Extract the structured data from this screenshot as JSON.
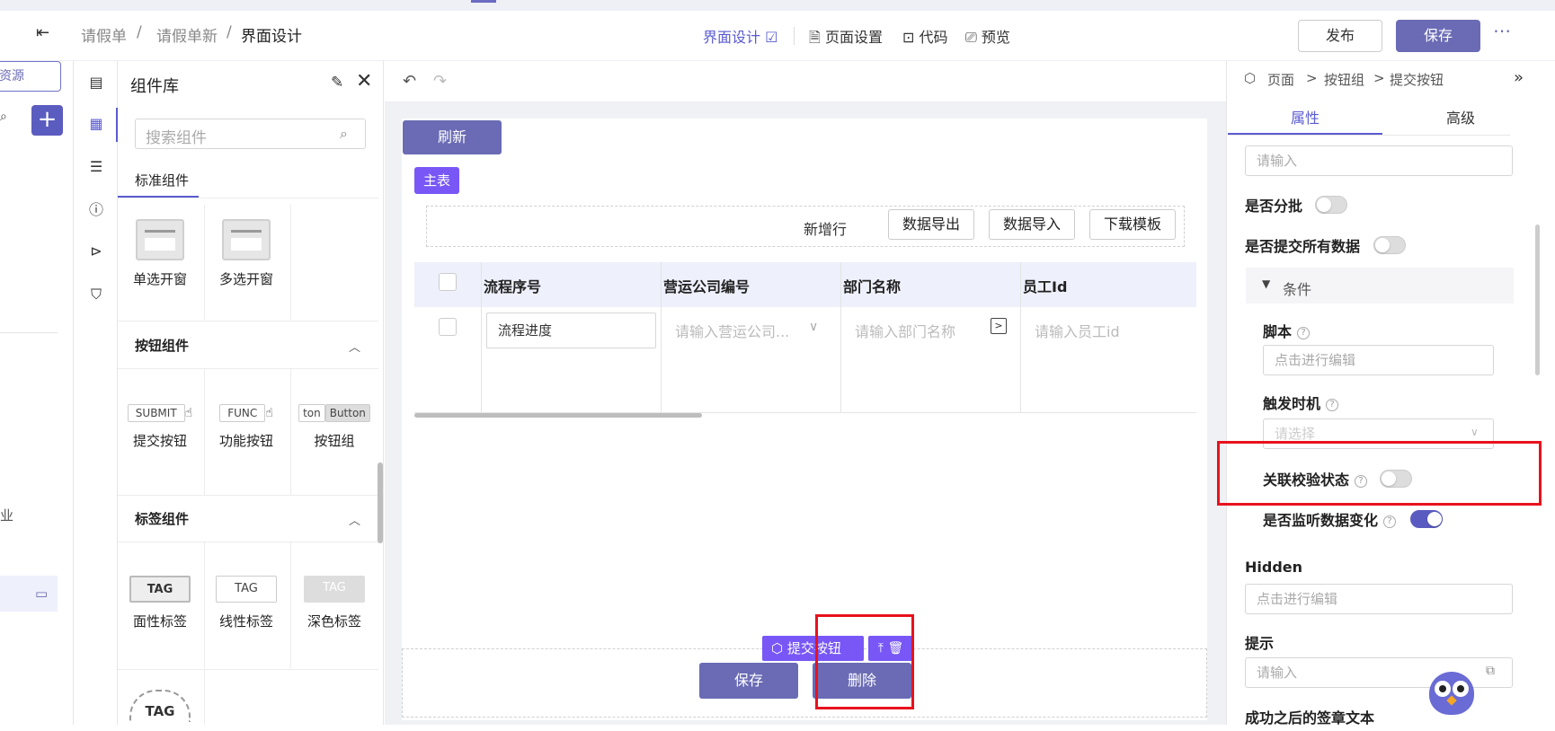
{
  "header": {
    "breadcrumb": [
      "请假单",
      "/",
      "请假单新",
      "/",
      "界面设计"
    ],
    "nav": {
      "design": "界面设计",
      "page_settings": "页面设置",
      "code": "代码",
      "preview": "预览"
    },
    "publish": "发布",
    "save": "保存",
    "more": "⋯"
  },
  "left_panel": {
    "resource_button": "资源",
    "partial_text": "业"
  },
  "library": {
    "title": "组件库",
    "search_placeholder": "搜索组件",
    "tab": "标准组件",
    "window_items": [
      "单选开窗",
      "多选开窗"
    ],
    "button_section": "按钮组件",
    "button_items": [
      {
        "label": "提交按钮",
        "preview": "SUBMIT"
      },
      {
        "label": "功能按钮",
        "preview": "FUNC"
      },
      {
        "label": "按钮组",
        "preview_a": "ton",
        "preview_b": "Button"
      }
    ],
    "tag_section": "标签组件",
    "tag_items": [
      {
        "label": "面性标签",
        "preview": "TAG"
      },
      {
        "label": "线性标签",
        "preview": "TAG"
      },
      {
        "label": "深色标签",
        "preview": "TAG"
      }
    ],
    "extra_tag": "TAG"
  },
  "canvas": {
    "refresh": "刷新",
    "main_table_tag": "主表",
    "new_row": "新增行",
    "export": "数据导出",
    "import": "数据导入",
    "download_template": "下载模板",
    "columns": [
      "流程序号",
      "营运公司编号",
      "部门名称",
      "员工Id"
    ],
    "row": {
      "process_value": "流程进度",
      "company_placeholder": "请输入营运公司...",
      "dept_placeholder": "请输入部门名称",
      "employee_placeholder": "请输入员工id"
    },
    "selected_tag": "提交按钮",
    "save": "保存",
    "delete": "删除"
  },
  "right_panel": {
    "breadcrumb": [
      "页面",
      ">",
      "按钮组",
      ">",
      "提交按钮"
    ],
    "tabs": [
      "属性",
      "高级"
    ],
    "top_input_placeholder": "请输入",
    "is_batch": "是否分批",
    "submit_all": "是否提交所有数据",
    "condition": "条件",
    "script_label": "脚本",
    "script_placeholder": "点击进行编辑",
    "trigger_label": "触发时机",
    "trigger_placeholder": "请选择",
    "linked_validation": "关联校验状态",
    "listen_change": "是否监听数据变化",
    "hidden_label": "Hidden",
    "hidden_placeholder": "点击进行编辑",
    "hint_label": "提示",
    "hint_placeholder": "请输入",
    "success_text": "成功之后的签章文本"
  },
  "toggles": {
    "is_batch": false,
    "submit_all": false,
    "linked_validation": false,
    "listen_change": true
  },
  "colors": {
    "accent": "#5a5bd0",
    "primary_button": "#6a6bb4",
    "tag_purple": "#7857f6",
    "highlight_red": "#e8121d"
  }
}
